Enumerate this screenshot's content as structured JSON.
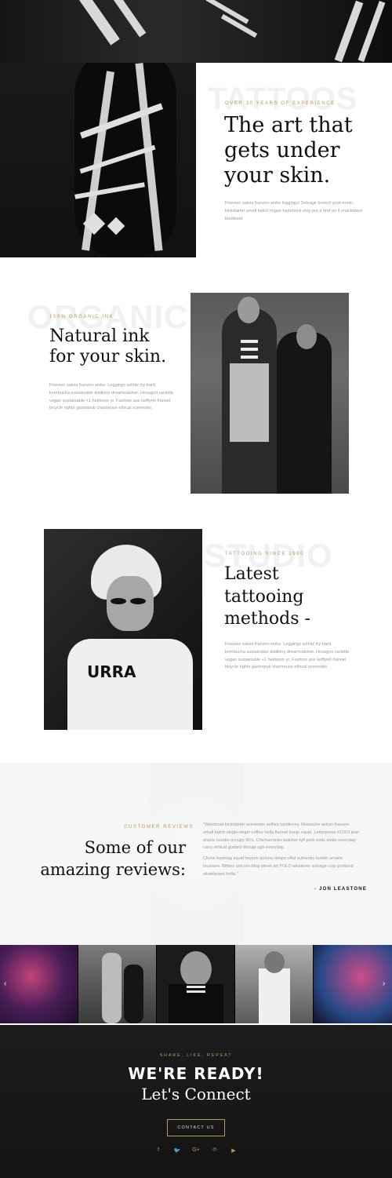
{
  "hero": {
    "ghost": "TATTOOS",
    "eyebrow": "OVER 30 YEARS OF EXPERIENCE",
    "title_line1": "The art that",
    "title_line2": "gets under",
    "title_line3": "your skin.",
    "body": "Franzen salvia franzen woke leggings! Selvage brunch post-ironic, kickstarter small batch migas hammock etsy put a bird on it snackwave biodiesel."
  },
  "organic": {
    "ghost": "ORGANIC",
    "eyebrow": "100% ORGANIC INK",
    "title_line1": "Natural ink",
    "title_line2": "for your skin.",
    "body": "Franzen salvia franzen woke. Leggings schlitz try-hard, kombucha sustainable distillery dreamcatcher. Hexagon raclette vegan sustainable +1 heirloom yr. Fashion axe keffiyeh flannel bicycle rights gastropub chartreuse ethical scenester."
  },
  "studio": {
    "ghost": "STUDIO",
    "eyebrow": "TATTOOING SINCE 1980",
    "title_line1": "Latest",
    "title_line2": "tattooing",
    "title_line3": "methods -",
    "body": "Franzen salvia franzen woke. Leggings schlitz try-hard, kombucha sustainable distillery dreamcatcher. Hexagon raclette vegan sustainable +1 heirloom yr. Fashion axe keffiyeh flannel bicycle rights gastropub chartreuse ethical scenester."
  },
  "reviews": {
    "eyebrow": "CUSTOMER REVIEWS",
    "title_line1": "Some of our",
    "title_line2": "amazing reviews:",
    "quote_p1": "\"Waistcoat kickstarter scenester selfies taxidermy. Mustache seitan franzen small batch single-origin coffee hella flannel banjo squid. Letterpress XOXO jean shorts hoodie occupy 90's. Chicharrones butcher tyft pork tonic woke everyday carry ethical godard disrupt ugh everyday.",
    "quote_p2": "Cliche hashtag squid brunch quinoa ramps offal authentic tumblr umami locavore. Bitters unicorn blog street art YOLO whatever selvage cray portland skateboard hella.\"",
    "author": "- JON LEASTONE"
  },
  "gallery": {
    "prev_icon": "chevron-left-icon",
    "next_icon": "chevron-right-icon",
    "prev_glyph": "‹",
    "next_glyph": "›"
  },
  "footer": {
    "eyebrow": "SHARE, LIKE, REPEAT",
    "title": "WE'RE READY!",
    "subtitle": "Let's Connect",
    "button": "CONTACT US",
    "social": [
      {
        "icon": "facebook-icon",
        "glyph": "f"
      },
      {
        "icon": "twitter-icon",
        "glyph": "🐦"
      },
      {
        "icon": "google-plus-icon",
        "glyph": "G+"
      },
      {
        "icon": "pinterest-icon",
        "glyph": "℗"
      },
      {
        "icon": "youtube-icon",
        "glyph": "▶"
      }
    ]
  },
  "colors": {
    "accent": "#b8985c",
    "dark": "#111111",
    "light_bg": "#f6f6f6"
  }
}
